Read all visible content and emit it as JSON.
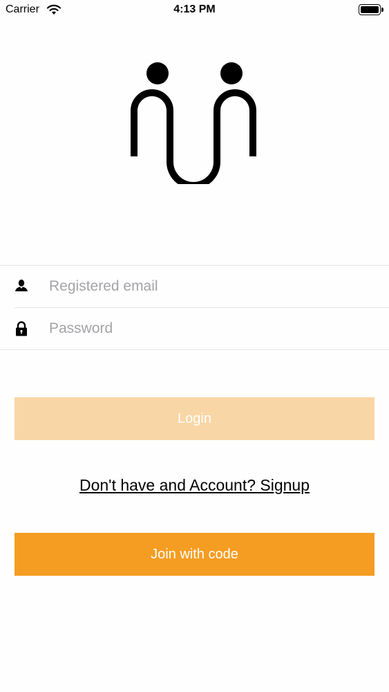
{
  "status_bar": {
    "carrier": "Carrier",
    "time": "4:13 PM",
    "icons": [
      "wifi-icon",
      "battery-icon"
    ]
  },
  "logo": {
    "icon": "two-people-logo-icon",
    "color": "#000000"
  },
  "form": {
    "email": {
      "placeholder": "Registered email",
      "value": "",
      "icon": "person-icon"
    },
    "password": {
      "placeholder": "Password",
      "value": "",
      "icon": "lock-icon"
    }
  },
  "login_button": {
    "label": "Login",
    "color": "#f9d6a5",
    "state": "disabled"
  },
  "signup_link": {
    "label": "Don't have and Account? Signup"
  },
  "join_button": {
    "label": "Join with code",
    "color": "#f59d22"
  }
}
